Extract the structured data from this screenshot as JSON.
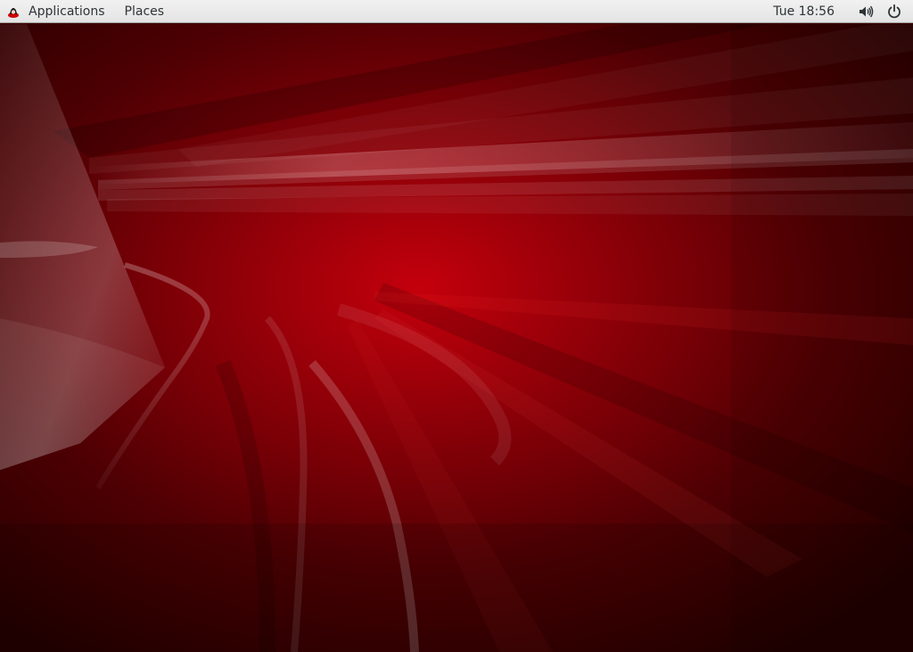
{
  "top_bar": {
    "applications_label": "Applications",
    "places_label": "Places",
    "clock": "Tue 18:56",
    "icons": {
      "app_logo": "redhat-logo-icon",
      "volume": "volume-icon",
      "power": "power-icon"
    }
  },
  "desktop": {
    "wallpaper": "red-abstract-wallpaper",
    "colors": {
      "base": "#3a0000",
      "highlight": "#c00010",
      "panel": "#e8e8e8"
    }
  }
}
